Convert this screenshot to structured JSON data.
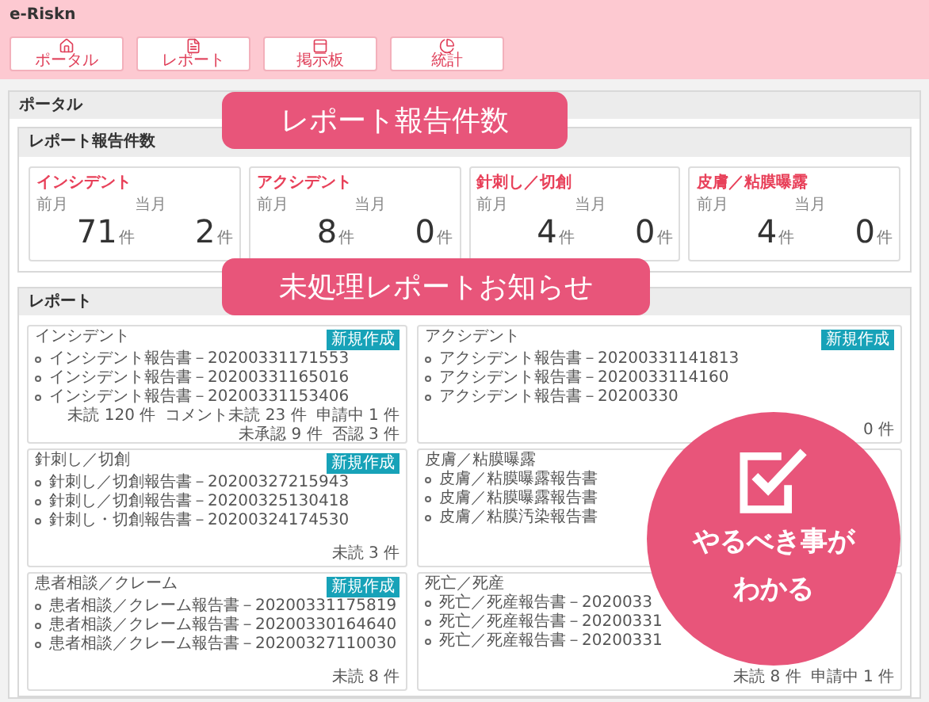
{
  "app": {
    "title": "e-Riskn"
  },
  "nav": [
    {
      "label": "ポータル",
      "kind": "home"
    },
    {
      "label": "レポート",
      "kind": "file"
    },
    {
      "label": "掲示板",
      "kind": "board"
    },
    {
      "label": "統計",
      "kind": "chart"
    }
  ],
  "portal": {
    "title": "ポータル",
    "counts": {
      "title": "レポート報告件数",
      "cards": [
        {
          "title": "インシデント",
          "prev_label": "前月",
          "prev": "71",
          "prev_unit": "件",
          "curr_label": "当月",
          "curr": "2",
          "curr_unit": "件"
        },
        {
          "title": "アクシデント",
          "prev_label": "前月",
          "prev": "8",
          "prev_unit": "件",
          "curr_label": "当月",
          "curr": "0",
          "curr_unit": "件"
        },
        {
          "title": "針刺し／切創",
          "prev_label": "前月",
          "prev": "4",
          "prev_unit": "件",
          "curr_label": "当月",
          "curr": "0",
          "curr_unit": "件"
        },
        {
          "title": "皮膚／粘膜曝露",
          "prev_label": "前月",
          "prev": "4",
          "prev_unit": "件",
          "curr_label": "当月",
          "curr": "0",
          "curr_unit": "件"
        }
      ]
    },
    "reports": {
      "title": "レポート",
      "cards": [
        {
          "title": "インシデント",
          "button": "新規作成",
          "items": [
            "インシデント報告書－20200331171553",
            "インシデント報告書－20200331165016",
            "インシデント報告書－20200331153406"
          ],
          "statuses": [
            "未読 120 件",
            "コメント未読 23 件",
            "申請中 1 件",
            "未承認 9 件",
            "否認 3 件"
          ]
        },
        {
          "title": "アクシデント",
          "button": "新規作成",
          "items": [
            "アクシデント報告書－20200331141813",
            "アクシデント報告書－2020033114160",
            "アクシデント報告書－20200330"
          ],
          "statuses": [
            "0 件"
          ]
        },
        {
          "title": "針刺し／切創",
          "button": "新規作成",
          "items": [
            "針刺し／切創報告書－20200327215943",
            "針刺し／切創報告書－20200325130418",
            "針刺し・切創報告書－20200324174530"
          ],
          "statuses": [
            "未読 3 件"
          ]
        },
        {
          "title": "皮膚／粘膜曝露",
          "items": [
            "皮膚／粘膜曝露報告書",
            "皮膚／粘膜曝露報告書",
            "皮膚／粘膜汚染報告書"
          ]
        },
        {
          "title": "患者相談／クレーム",
          "button": "新規作成",
          "items": [
            "患者相談／クレーム報告書－20200331175819",
            "患者相談／クレーム報告書－20200330164640",
            "患者相談／クレーム報告書－20200327110030"
          ],
          "statuses": [
            "未読 8 件"
          ]
        },
        {
          "title": "死亡／死産",
          "items": [
            "死亡／死産報告書－2020033",
            "死亡／死産報告書－20200331",
            "死亡／死産報告書－20200331"
          ],
          "statuses": [
            "未読 8 件",
            "申請中 1 件"
          ]
        }
      ]
    }
  },
  "callouts": [
    {
      "text": "レポート報告件数"
    },
    {
      "text": "未処理レポートお知らせ"
    }
  ],
  "badge": {
    "lines": [
      "やるべき事が",
      "わかる"
    ]
  }
}
